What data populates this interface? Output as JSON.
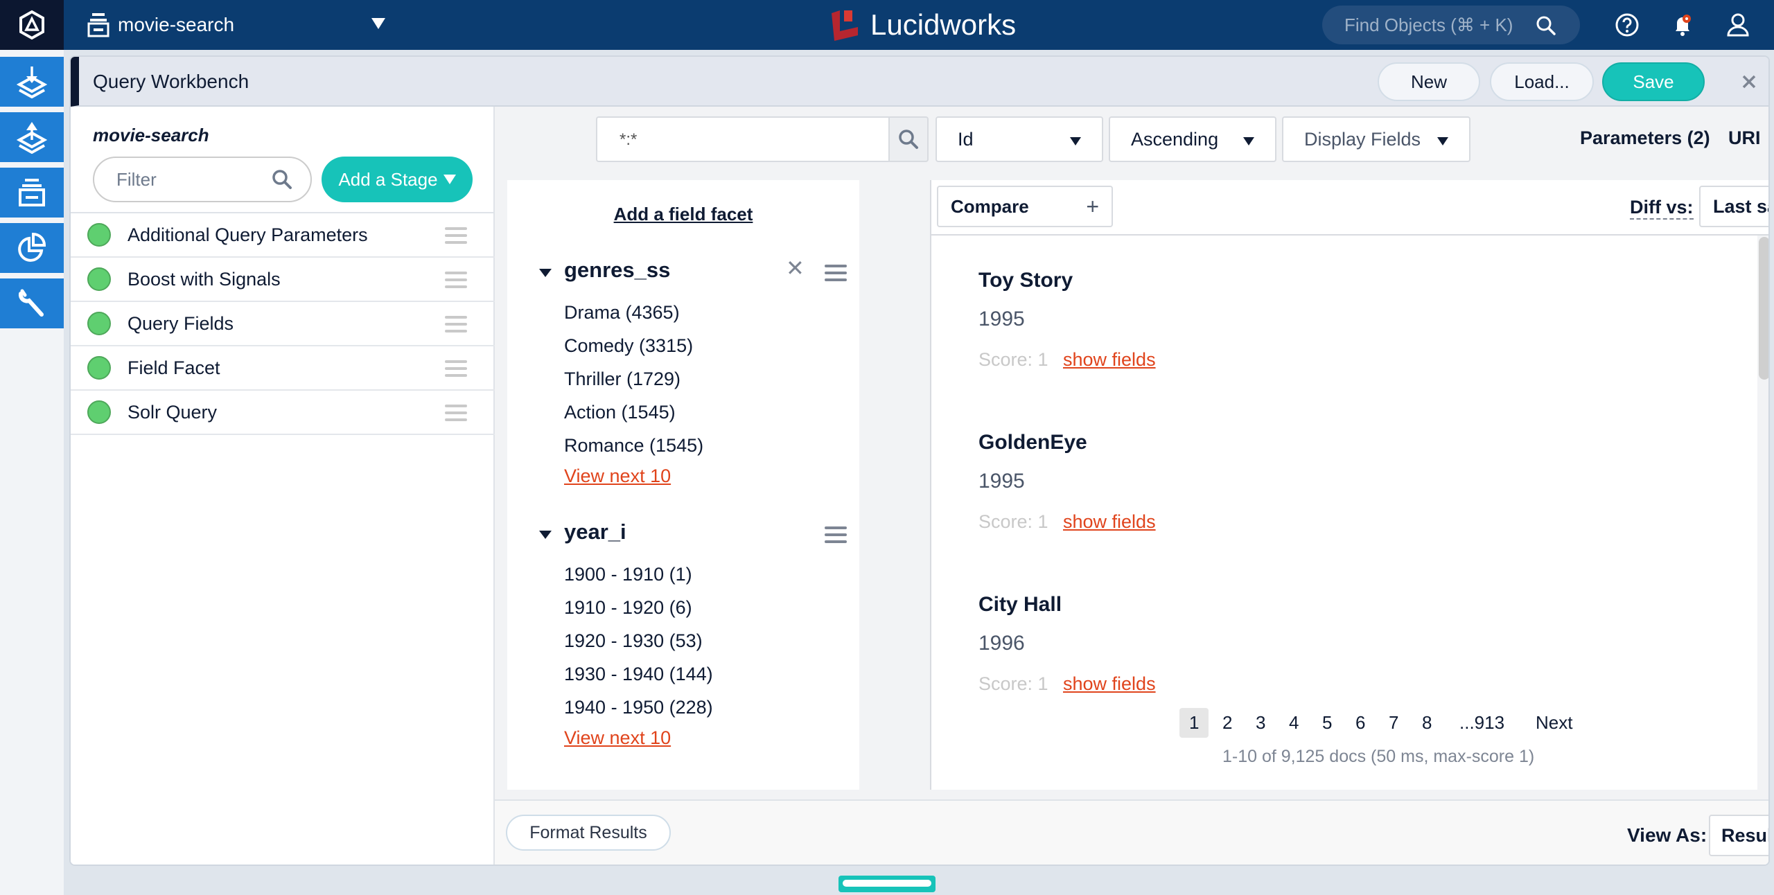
{
  "topbar": {
    "app_name": "movie-search",
    "logo_text": "Lucidworks",
    "find_placeholder": "Find Objects (⌘ + K)",
    "notification_dot_color": "#e0441c"
  },
  "rail": {
    "items": [
      {
        "name": "index-workbench",
        "icon": "layers-download-icon"
      },
      {
        "name": "query-workbench",
        "icon": "layers-upload-icon"
      },
      {
        "name": "collections",
        "icon": "archive-icon"
      },
      {
        "name": "analytics",
        "icon": "pie-chart-icon"
      },
      {
        "name": "system",
        "icon": "wrench-icon"
      }
    ]
  },
  "panel": {
    "title": "Query Workbench",
    "buttons": {
      "new": "New",
      "load": "Load...",
      "save": "Save"
    }
  },
  "stages": {
    "pipeline_name": "movie-search",
    "filter_placeholder": "Filter",
    "add_stage_label": "Add a Stage",
    "items": [
      {
        "label": "Additional Query Parameters",
        "status": "enabled"
      },
      {
        "label": "Boost with Signals",
        "status": "enabled"
      },
      {
        "label": "Query Fields",
        "status": "enabled"
      },
      {
        "label": "Field Facet",
        "status": "enabled"
      },
      {
        "label": "Solr Query",
        "status": "enabled"
      }
    ]
  },
  "query": {
    "value": "*:*",
    "sort_field": "Id",
    "sort_order": "Ascending",
    "display_fields": "Display Fields",
    "parameters_label": "Parameters (2)",
    "uri_label": "URI"
  },
  "facets": {
    "add_label": "Add a field facet",
    "groups": [
      {
        "field": "genres_ss",
        "values": [
          "Drama (4365)",
          "Comedy (3315)",
          "Thriller (1729)",
          "Action (1545)",
          "Romance (1545)"
        ],
        "more_label": "View next 10"
      },
      {
        "field": "year_i",
        "values": [
          "1900 - 1910 (1)",
          "1910 - 1920 (6)",
          "1920 - 1930 (53)",
          "1930 - 1940 (144)",
          "1940 - 1950 (228)"
        ],
        "more_label": "View next 10"
      }
    ]
  },
  "results": {
    "compare_label": "Compare",
    "diff_label": "Diff vs:",
    "diff_value": "Last save",
    "docs": [
      {
        "title": "Toy Story",
        "year": "1995",
        "score": "Score: 1",
        "show": "show fields"
      },
      {
        "title": "GoldenEye",
        "year": "1995",
        "score": "Score: 1",
        "show": "show fields"
      },
      {
        "title": "City Hall",
        "year": "1996",
        "score": "Score: 1",
        "show": "show fields"
      }
    ],
    "pagination": {
      "pages": [
        "1",
        "2",
        "3",
        "4",
        "5",
        "6",
        "7",
        "8",
        "...913"
      ],
      "current": "1",
      "next_label": "Next"
    },
    "summary": "1-10 of 9,125 docs (50 ms, max-score 1)"
  },
  "footer": {
    "format_label": "Format Results",
    "view_as_label": "View As:",
    "view_as_value": "Results"
  }
}
